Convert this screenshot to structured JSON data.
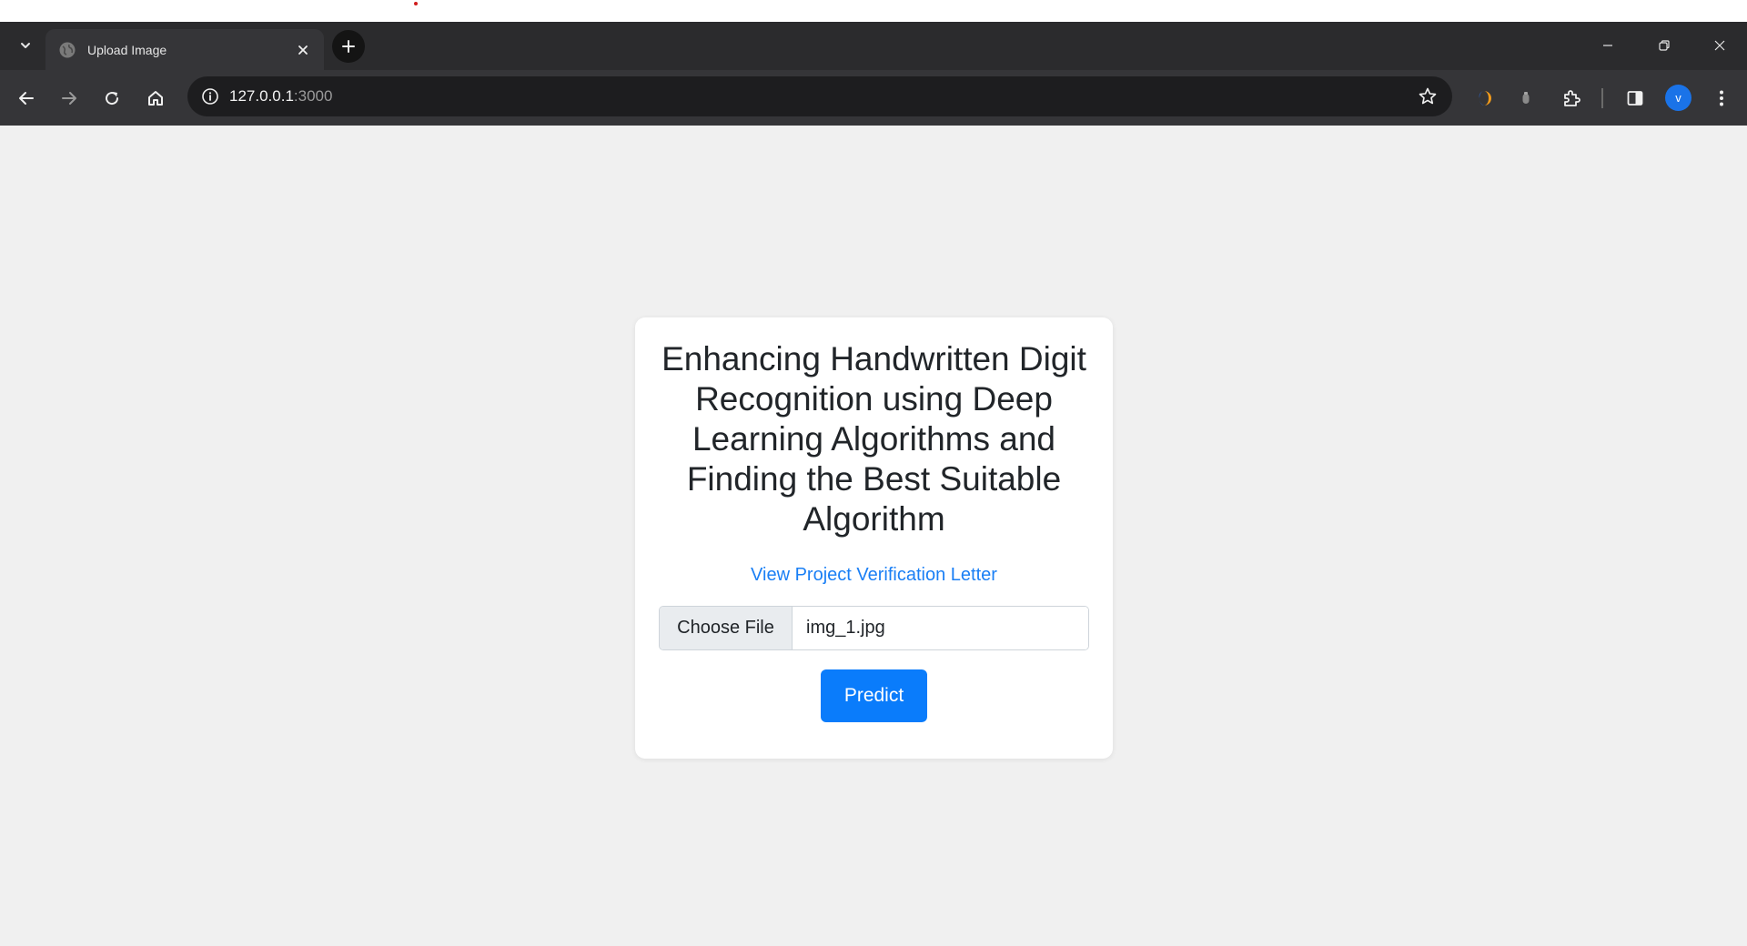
{
  "browser": {
    "tab": {
      "title": "Upload Image",
      "favicon": "globe-icon"
    },
    "address": {
      "host": "127.0.0.1",
      "port": ":3000"
    },
    "profile_initial": "v",
    "colors": {
      "frame": "#2b2b2d",
      "toolbar": "#353538",
      "avatar": "#1a73e8"
    }
  },
  "page": {
    "title": "Enhancing Handwritten Digit Recognition using Deep Learning Algorithms and Finding the Best Suitable Algorithm",
    "link_text": "View Project Verification Letter",
    "file_input": {
      "button_label": "Choose File",
      "selected_file": "img_1.jpg"
    },
    "submit_label": "Predict",
    "colors": {
      "background": "#f0f0f0",
      "link": "#1a7ff5",
      "primary": "#0a7cfb"
    }
  }
}
